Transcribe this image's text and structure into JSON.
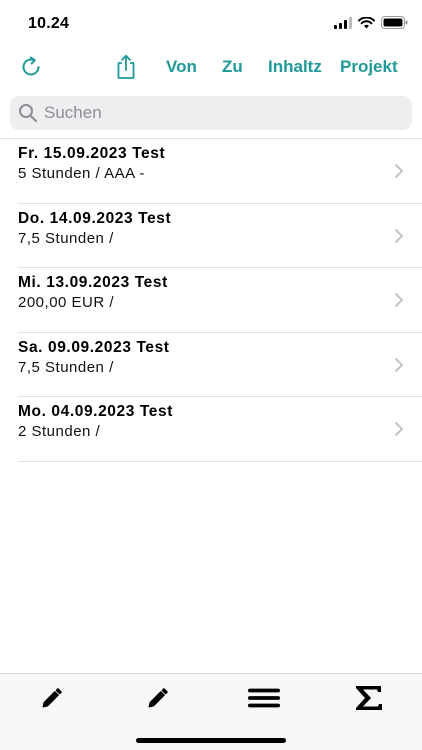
{
  "status_bar": {
    "time": "10.24"
  },
  "toolbar": {
    "refresh_icon": "refresh-icon",
    "share_icon": "share-icon",
    "von": "Von",
    "zu": "Zu",
    "inhaltz": "Inhaltz",
    "projekt": "Projekt",
    "accent_color": "#1f9a96"
  },
  "search": {
    "placeholder": "Suchen",
    "value": ""
  },
  "entries": [
    {
      "title": "Fr. 15.09.2023  Test",
      "subtitle": "5 Stunden / AAA -"
    },
    {
      "title": "Do. 14.09.2023  Test",
      "subtitle": "7,5 Stunden /"
    },
    {
      "title": "Mi. 13.09.2023  Test",
      "subtitle": "200,00 EUR /"
    },
    {
      "title": "Sa. 09.09.2023  Test",
      "subtitle": "7,5 Stunden /"
    },
    {
      "title": "Mo. 04.09.2023  Test",
      "subtitle": "2 Stunden /"
    }
  ],
  "tabbar": {
    "tabs": [
      {
        "icon": "pencil-icon"
      },
      {
        "icon": "pencil-icon"
      },
      {
        "icon": "menu-icon"
      },
      {
        "icon": "sigma-icon"
      }
    ]
  }
}
